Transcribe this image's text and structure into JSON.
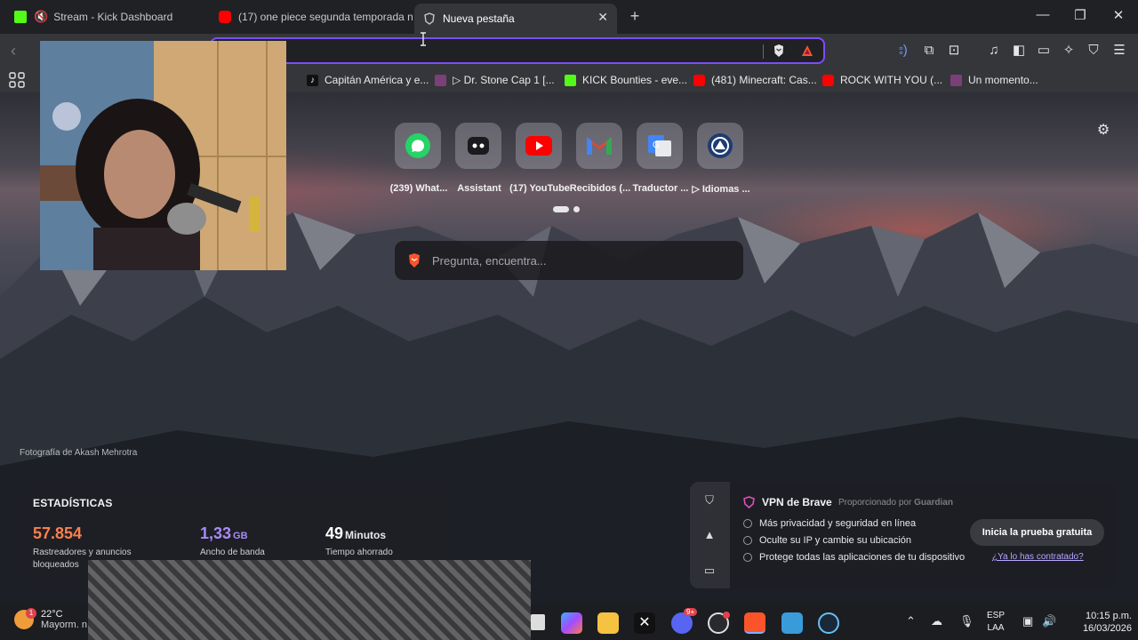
{
  "tabs": [
    {
      "title": "Stream - Kick Dashboard",
      "favicon_color": "#53fc18"
    },
    {
      "title": "(17) one piece segunda temporada n",
      "favicon_color": "#ff0000"
    },
    {
      "title": "Nueva pestaña",
      "favicon_color": "#9aa0a6"
    }
  ],
  "toolbar": {
    "address_value": "",
    "address_placeholder": ""
  },
  "bookmarks": [
    {
      "label": "Capitán América y e...",
      "icon": "tiktok-icon"
    },
    {
      "label": "▷ Dr. Stone Cap 1 [...",
      "icon": "anime-icon"
    },
    {
      "label": "KICK Bounties - eve...",
      "icon": "kick-icon"
    },
    {
      "label": "(481) Minecraft: Cas...",
      "icon": "youtube-icon"
    },
    {
      "label": "ROCK WITH YOU (...",
      "icon": "youtube-icon"
    },
    {
      "label": "Un momento...",
      "icon": "anime-icon"
    }
  ],
  "top_sites": [
    {
      "label": "(239) What...",
      "icon": "whatsapp-icon"
    },
    {
      "label": "Assistant",
      "icon": "assistant-icon"
    },
    {
      "label": "(17) YouTube",
      "icon": "youtube-icon"
    },
    {
      "label": "Recibidos (...",
      "icon": "gmail-icon"
    },
    {
      "label": "Traductor ...",
      "icon": "translate-icon"
    },
    {
      "label": "▷ Idiomas ...",
      "icon": "idiomas-icon"
    }
  ],
  "search": {
    "placeholder": "Pregunta, encuentra..."
  },
  "photo_credit": "Fotografía de Akash Mehrotra",
  "stats": {
    "title": "ESTADÍSTICAS",
    "items": [
      {
        "value": "57.854",
        "unit": "",
        "label_line1": "Rastreadores y anuncios",
        "label_line2": "bloqueados",
        "color": "#fb7f4f"
      },
      {
        "value": "1,33",
        "unit": "GB",
        "label_line1": "Ancho de banda",
        "label_line2": "",
        "color": "#a78bfa"
      },
      {
        "value": "49",
        "unit": "Minutos",
        "label_line1": "Tiempo ahorrado",
        "label_line2": "",
        "color": "#ffffff"
      }
    ]
  },
  "vpn": {
    "title": "VPN de Brave",
    "provided_by": "Proporcionado por",
    "provider": "Guardian",
    "features": [
      "Más privacidad y seguridad en línea",
      "Oculte su IP y cambie su ubicación",
      "Protege todas las aplicaciones de tu dispositivo"
    ],
    "cta": "Inicia la prueba gratuita",
    "link": "¿Ya lo has contratado?"
  },
  "taskbar": {
    "temperature": "22°C",
    "weather_desc": "Mayorm. n",
    "weather_badge": "1",
    "discord_badge": "9+",
    "lang_line1": "ESP",
    "lang_line2": "LAA",
    "time": "10:15 p.m.",
    "date": "16/03/2026"
  },
  "colors": {
    "accent": "#7b4dff",
    "kick_green": "#53fc18",
    "brave_orange": "#fb542b"
  }
}
